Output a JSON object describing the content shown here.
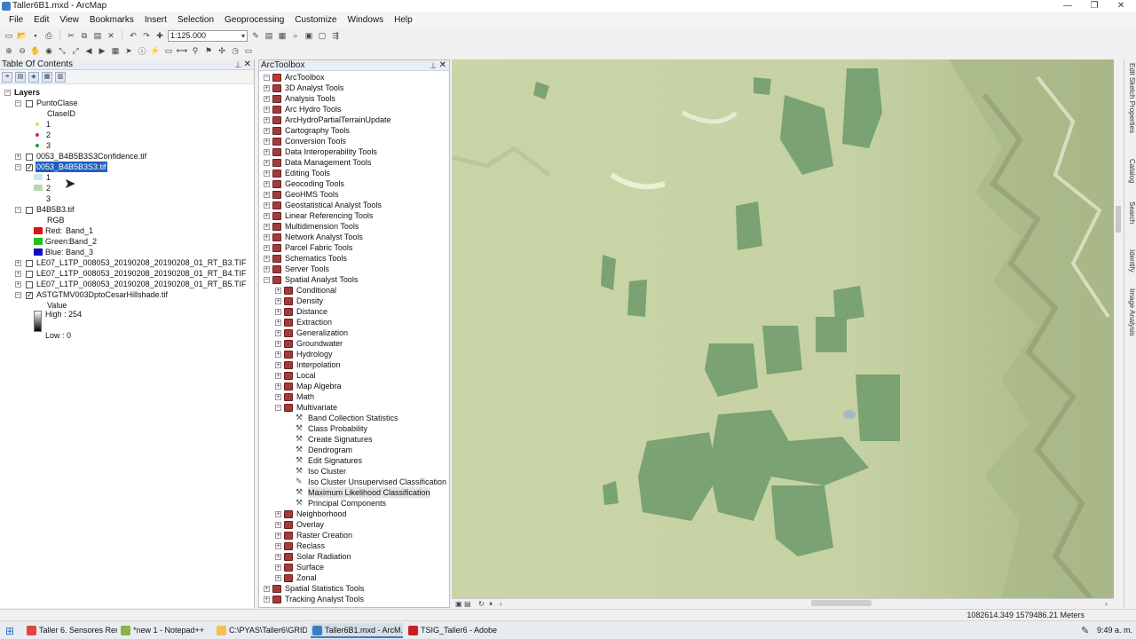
{
  "window": {
    "title": "Taller6B1.mxd - ArcMap"
  },
  "menu": [
    "File",
    "Edit",
    "View",
    "Bookmarks",
    "Insert",
    "Selection",
    "Geoprocessing",
    "Customize",
    "Windows",
    "Help"
  ],
  "standard_toolbar": {
    "scale": "1:125.000"
  },
  "toc": {
    "title": "Table Of Contents",
    "root": "Layers",
    "layers": {
      "puntoclase": "PuntoClase",
      "puntoclase_field": "ClaseID",
      "puntoclase_vals": [
        "1",
        "2",
        "3"
      ],
      "confidence": "0053_B4B5B3S3Confidence.tif",
      "selected": "0053_B4B5B3S3.tif",
      "selected_vals": [
        "1",
        "2",
        "3"
      ],
      "b4b5b3": "B4B5B3.tif",
      "rgb": "RGB",
      "red": "Red:",
      "red_band": "Band_1",
      "green": "Green:",
      "green_band": "Band_2",
      "blue": "Blue:",
      "blue_band": "Band_3",
      "le07_b3": "LE07_L1TP_008053_20190208_20190208_01_RT_B3.TIF",
      "le07_b4": "LE07_L1TP_008053_20190208_20190208_01_RT_B4.TIF",
      "le07_b5": "LE07_L1TP_008053_20190208_20190208_01_RT_B5.TIF",
      "hillshade": "ASTGTMV003DptoCesarHillshade.tif",
      "value": "Value",
      "high": "High : 254",
      "low": "Low : 0"
    }
  },
  "arctoolbox": {
    "title": "ArcToolbox",
    "root": "ArcToolbox",
    "toolboxes_top": [
      "3D Analyst Tools",
      "Analysis Tools",
      "Arc Hydro Tools",
      "ArcHydroPartialTerrainUpdate",
      "Cartography Tools",
      "Conversion Tools",
      "Data Interoperability Tools",
      "Data Management Tools",
      "Editing Tools",
      "Geocoding Tools",
      "GeoHMS Tools",
      "Geostatistical Analyst Tools",
      "Linear Referencing Tools",
      "Multidimension Tools",
      "Network Analyst Tools",
      "Parcel Fabric Tools",
      "Schematics Tools",
      "Server Tools"
    ],
    "spatial_analyst": "Spatial Analyst Tools",
    "sa_sets_before": [
      "Conditional",
      "Density",
      "Distance",
      "Extraction",
      "Generalization",
      "Groundwater",
      "Hydrology",
      "Interpolation",
      "Local",
      "Map Algebra",
      "Math"
    ],
    "multivariate": "Multivariate",
    "multivariate_tools": [
      "Band Collection Statistics",
      "Class Probability",
      "Create Signatures",
      "Dendrogram",
      "Edit Signatures",
      "Iso Cluster",
      "Iso Cluster Unsupervised Classification",
      "Maximum Likelihood Classification",
      "Principal Components"
    ],
    "sa_sets_after": [
      "Neighborhood",
      "Overlay",
      "Raster Creation",
      "Reclass",
      "Solar Radiation",
      "Surface",
      "Zonal"
    ],
    "toolboxes_bottom": [
      "Spatial Statistics Tools",
      "Tracking Analyst Tools"
    ]
  },
  "right_dock": [
    "Edit Sketch Properties",
    "Catalog",
    "Search",
    "Identify",
    "Image Analysis"
  ],
  "status": {
    "coords": "1082614.349  1579486.21 Meters"
  },
  "taskbar": {
    "items": [
      "Taller 6. Sensores Rem...",
      "*new 1 - Notepad++",
      "C:\\PYAS\\Taller6\\GRID...",
      "Taller6B1.mxd - ArcM...",
      "TSIG_Taller6 - Adobe ..."
    ],
    "clock": "9:49 a. m."
  },
  "colors": {
    "map_base": "#c8d4a6",
    "map_veg": "#6d9a6a",
    "toolbox_red": "#a43a3a",
    "selection": "#1f5fbf"
  }
}
